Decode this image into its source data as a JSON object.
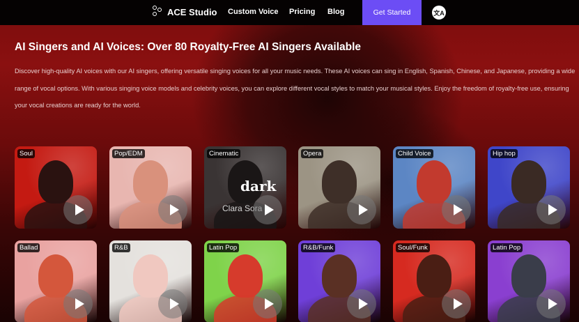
{
  "nav": {
    "brand": "ACE Studio",
    "links": [
      "Custom Voice",
      "Pricing",
      "Blog"
    ],
    "cta": "Get Started",
    "lang_icon": "translate-icon"
  },
  "hero": {
    "title": "AI Singers and AI Voices: Over 80 Royalty-Free AI Singers Available",
    "description": "Discover high-quality AI voices with our AI singers, offering versatile singing voices for all your music needs. These AI voices can sing in English, Spanish, Chinese, and Japanese, providing a wide range of vocal options. With various singing voice models and celebrity voices, you can explore different vocal styles to match your musical styles. Enjoy the freedom of royalty-free use, ensuring your vocal creations are ready for the world."
  },
  "cards": [
    {
      "tag": "Soul",
      "bg": "#c41a12",
      "fig": "#2a1210"
    },
    {
      "tag": "Pop/EDM",
      "bg": "#e8b6b0",
      "fig": "#d9917c"
    },
    {
      "tag": "Cinematic",
      "bg": "#3a3434",
      "fig": "#1a1616",
      "overlay": "dark",
      "name": "Clara Sora"
    },
    {
      "tag": "Opera",
      "bg": "#9c9484",
      "fig": "#3e2f28"
    },
    {
      "tag": "Child Voice",
      "bg": "#5c86c4",
      "fig": "#c23a2e"
    },
    {
      "tag": "Hip hop",
      "bg": "#3f46c9",
      "fig": "#3a2a24"
    },
    {
      "tag": "Ballad",
      "bg": "#e9a2a0",
      "fig": "#d4573c"
    },
    {
      "tag": "R&B",
      "bg": "#e4e1dd",
      "fig": "#f0c8c0"
    },
    {
      "tag": "Latin Pop",
      "bg": "#7fd34a",
      "fig": "#d63b2c"
    },
    {
      "tag": "R&B/Funk",
      "bg": "#6f3fd8",
      "fig": "#5a3024"
    },
    {
      "tag": "Soul/Funk",
      "bg": "#d62a20",
      "fig": "#4a1e14"
    },
    {
      "tag": "Latin Pop",
      "bg": "#8a3fd0",
      "fig": "#3a3d4a"
    }
  ]
}
